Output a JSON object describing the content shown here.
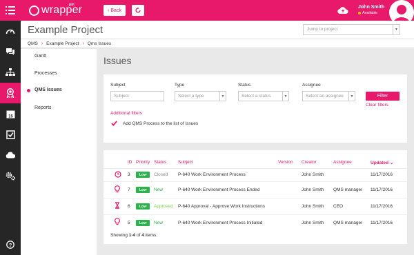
{
  "app": {
    "logo_text": "wrapper",
    "logo_badge": "pm"
  },
  "toolbar": {
    "back_label": "Back"
  },
  "user": {
    "name": "John Smith",
    "status": "Available"
  },
  "header": {
    "project_title": "Example Project",
    "jump_placeholder": "Jump to project"
  },
  "breadcrumb": [
    "QMS",
    "Example Project",
    "Qms Issues"
  ],
  "subnav": [
    "Gantt",
    "Processes",
    "QMS Issues",
    "Reports"
  ],
  "page": {
    "title": "Issues"
  },
  "filters": {
    "subject_label": "Subject",
    "subject_placeholder": "Subject",
    "type_label": "Type",
    "type_placeholder": "Select a type",
    "status_label": "Status",
    "status_placeholder": "Select a status",
    "assignee_label": "Assignee",
    "assignee_placeholder": "Select an assignee",
    "filter_button": "Filter",
    "clear_label": "Clear filters",
    "additional_label": "Additional filters",
    "add_process_label": "Add QMS Process to the list of Issues"
  },
  "table": {
    "headers": [
      "ID",
      "Priority",
      "Status",
      "Subject",
      "Version",
      "Creator",
      "Assignee",
      "Updated"
    ],
    "sort_arrow": "⌄",
    "rows": [
      {
        "icon": "clock-icon",
        "id": "3",
        "priority": "Low",
        "status": "Closed",
        "status_color": "#888888",
        "subject": "P-640 Work Environment Process",
        "version": "",
        "creator": "John Smith",
        "assignee": "",
        "updated": "11/17/2016"
      },
      {
        "icon": "lightbulb-icon",
        "id": "7",
        "priority": "Low",
        "status": "New",
        "status_color": "#29b34a",
        "subject": "P-640 Work Environment Process Ended",
        "version": "",
        "creator": "John Smith",
        "assignee": "QMS manager",
        "updated": "11/17/2016"
      },
      {
        "icon": "hourglass-icon",
        "id": "6",
        "priority": "Low",
        "status": "Approved",
        "status_color": "#7bd44a",
        "subject": "P-640 Approval - Approve Work Instructions",
        "version": "",
        "creator": "John Smith",
        "assignee": "CEO",
        "updated": "11/17/2016"
      },
      {
        "icon": "lightbulb-icon",
        "id": "5",
        "priority": "Low",
        "status": "New",
        "status_color": "#29b34a",
        "subject": "P-640 Work Environment Process Initiated",
        "version": "",
        "creator": "John Smith",
        "assignee": "QMS manager",
        "updated": "11/17/2016"
      }
    ],
    "footer_prefix": "Showing ",
    "footer_range": "1-4",
    "footer_middle": " of ",
    "footer_total": "4",
    "footer_suffix": " items."
  },
  "colors": {
    "accent": "#e8196b",
    "dark_rail": "#262626",
    "low_priority": "#29b34a"
  }
}
